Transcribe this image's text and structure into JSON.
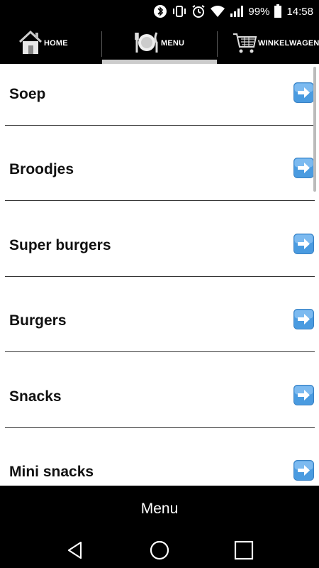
{
  "status_bar": {
    "battery": "99%",
    "time": "14:58",
    "icons": [
      "bluetooth-icon",
      "vibrate-icon",
      "alarm-icon",
      "wifi-icon",
      "signal-icon",
      "battery-icon"
    ]
  },
  "tabs": [
    {
      "label": "HOME",
      "icon": "house-icon"
    },
    {
      "label": "MENU",
      "icon": "plate-cutlery-icon",
      "active": true
    },
    {
      "label": "WINKELWAGEN",
      "icon": "shopping-cart-icon"
    }
  ],
  "menu_items": [
    {
      "label": "Soep"
    },
    {
      "label": "Broodjes"
    },
    {
      "label": "Super burgers"
    },
    {
      "label": "Burgers"
    },
    {
      "label": "Snacks"
    },
    {
      "label": "Mini snacks"
    }
  ],
  "bottom_bar": {
    "title": "Menu"
  },
  "android_nav": [
    "back-icon",
    "home-circle-icon",
    "recents-icon"
  ],
  "colors": {
    "background": "#000000",
    "content": "#ffffff",
    "arrow_button": "#4a9be0",
    "tab_indicator": "#cccccc"
  }
}
